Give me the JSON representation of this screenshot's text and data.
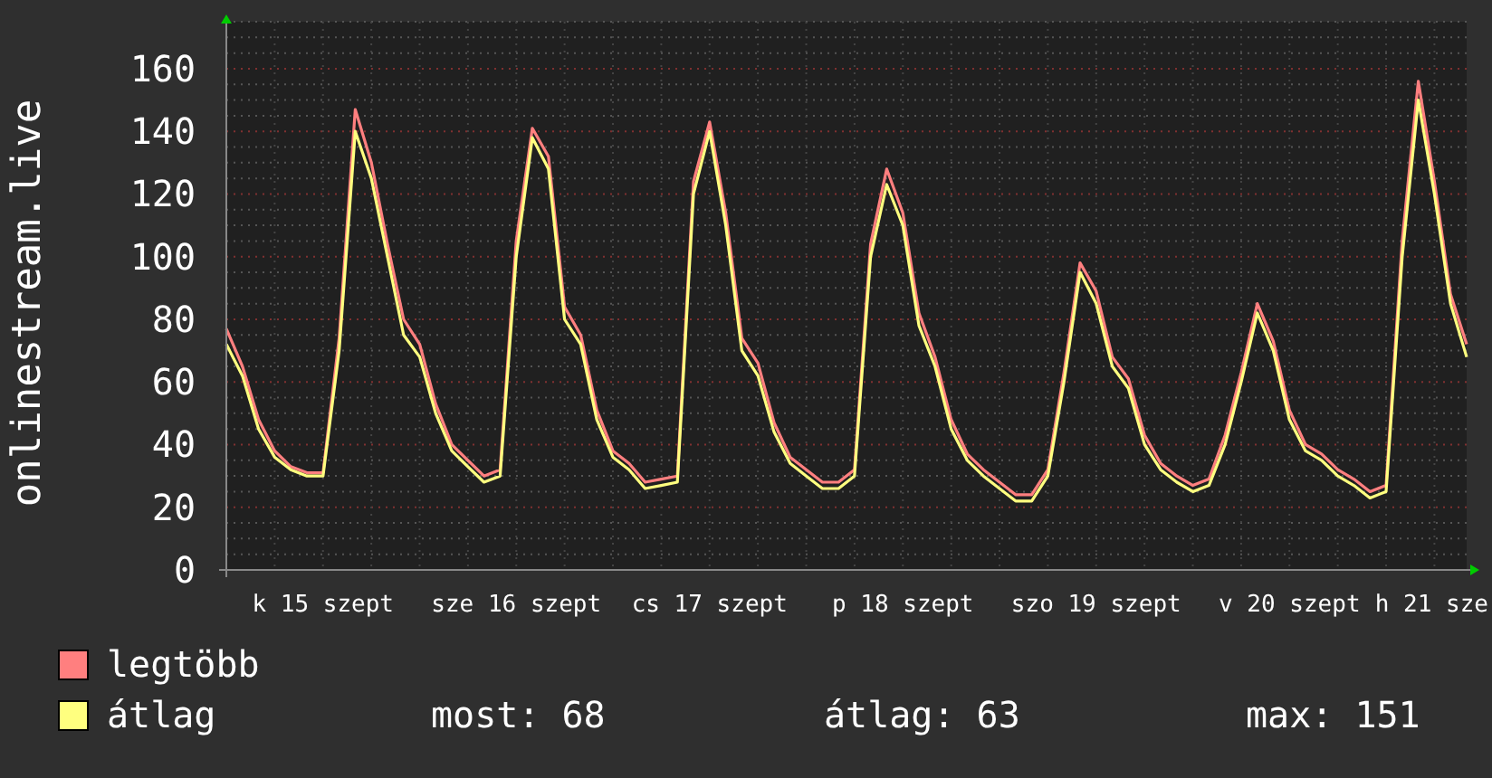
{
  "plot": {
    "chart_data": {
      "type": "line",
      "ylabel": "onlinestream.live",
      "ylim": [
        0,
        175
      ],
      "yticks": [
        0,
        20,
        40,
        60,
        80,
        100,
        120,
        140,
        160
      ],
      "grid": true,
      "series": [
        {
          "name": "legtöbb",
          "color": "#ff7f7f",
          "values": [
            77,
            65,
            48,
            38,
            33,
            31,
            31,
            74,
            147,
            130,
            104,
            80,
            72,
            53,
            40,
            35,
            30,
            32,
            105,
            141,
            132,
            84,
            75,
            51,
            38,
            34,
            28,
            29,
            30,
            124,
            143,
            114,
            74,
            66,
            47,
            36,
            32,
            28,
            28,
            32,
            104,
            128,
            114,
            82,
            68,
            48,
            37,
            32,
            28,
            24,
            24,
            32,
            63,
            98,
            89,
            68,
            61,
            43,
            34,
            30,
            27,
            29,
            43,
            63,
            85,
            73,
            51,
            40,
            37,
            32,
            29,
            25,
            27,
            105,
            156,
            124,
            88,
            72
          ]
        },
        {
          "name": "átlag",
          "color": "#ffff7f",
          "values": [
            72,
            62,
            45,
            36,
            32,
            30,
            30,
            70,
            140,
            125,
            100,
            75,
            68,
            50,
            38,
            33,
            28,
            30,
            100,
            138,
            128,
            80,
            72,
            48,
            36,
            32,
            26,
            27,
            28,
            120,
            140,
            110,
            70,
            62,
            44,
            34,
            30,
            26,
            26,
            30,
            100,
            123,
            110,
            78,
            65,
            45,
            35,
            30,
            26,
            22,
            22,
            30,
            60,
            95,
            85,
            65,
            58,
            40,
            32,
            28,
            25,
            27,
            40,
            60,
            82,
            70,
            48,
            38,
            35,
            30,
            27,
            23,
            25,
            100,
            150,
            120,
            85,
            68
          ]
        }
      ]
    },
    "x_labels": [
      "k 15 szept",
      "sze 16 szept",
      "cs 17 szept",
      "p 18 szept",
      "szo 19 szept",
      "v 20 szept",
      "h 21 sze"
    ],
    "legend_stats": [
      "most: 68",
      "átlag: 63",
      "max: 151"
    ]
  }
}
